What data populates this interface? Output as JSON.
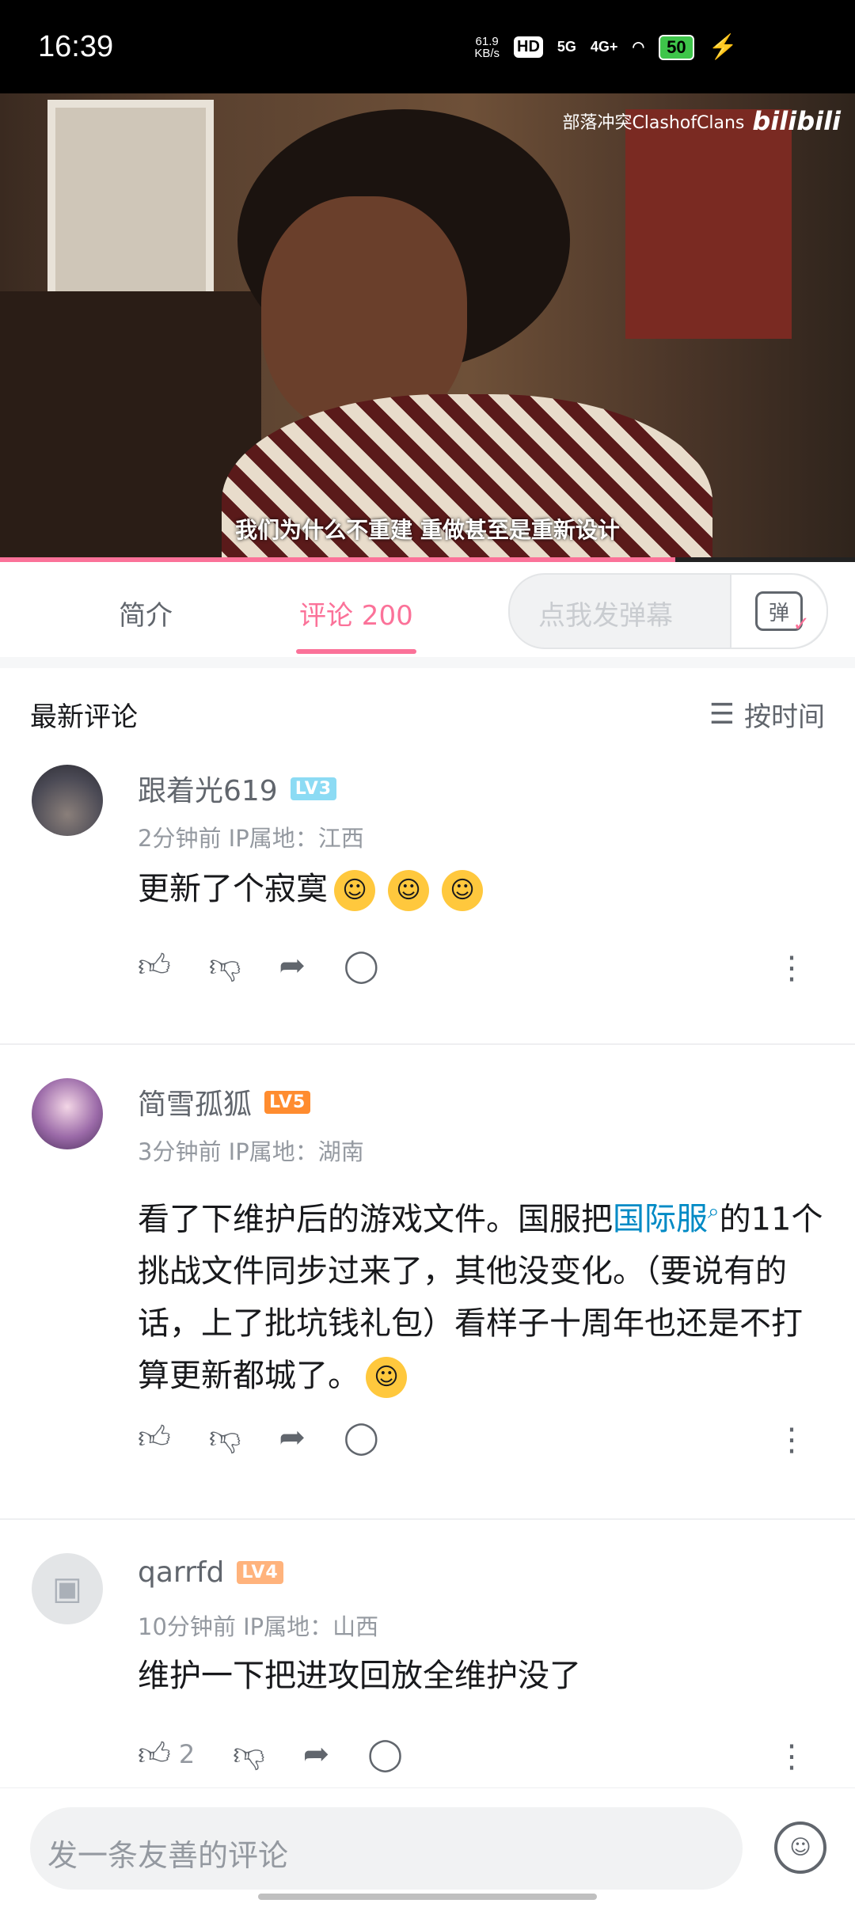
{
  "status_bar": {
    "time": "16:39",
    "speed": "61.9",
    "speed_unit": "KB/s",
    "hd": "HD",
    "net5g": "5G",
    "net4g": "4G+",
    "wifi_icon": "wifi-icon",
    "battery": "50"
  },
  "video": {
    "watermark": "部落冲突ClashofClans",
    "logo": "bilibili",
    "subtitle": "我们为什么不重建 重做甚至是重新设计",
    "progress": 0.79
  },
  "tabs": {
    "intro": "简介",
    "comments": "评论 200",
    "danmaku_placeholder": "点我发弹幕",
    "danmaku_icon_label": "弹"
  },
  "sort": {
    "title": "最新评论",
    "button": "按时间"
  },
  "comments": [
    {
      "username": "跟着光619",
      "level": "LV3",
      "meta": "2分钟前  IP属地：江西",
      "text": "更新了个寂寞",
      "likes": ""
    },
    {
      "username": "简雪孤狐",
      "level": "LV5",
      "meta": "3分钟前  IP属地：湖南",
      "text_pre": "看了下维护后的游戏文件。国服把",
      "link": "国际服",
      "text_post": "的11个挑战文件同步过来了，其他没变化。（要说有的话，上了批坑钱礼包）看样子十周年也还是不打算更新都城了。",
      "likes": ""
    },
    {
      "username": "qarrfd",
      "level": "LV4",
      "meta": "10分钟前  IP属地：山西",
      "text": "维护一下把进攻回放全维护没了",
      "likes": "2"
    }
  ],
  "bottom": {
    "placeholder": "发一条友善的评论"
  }
}
